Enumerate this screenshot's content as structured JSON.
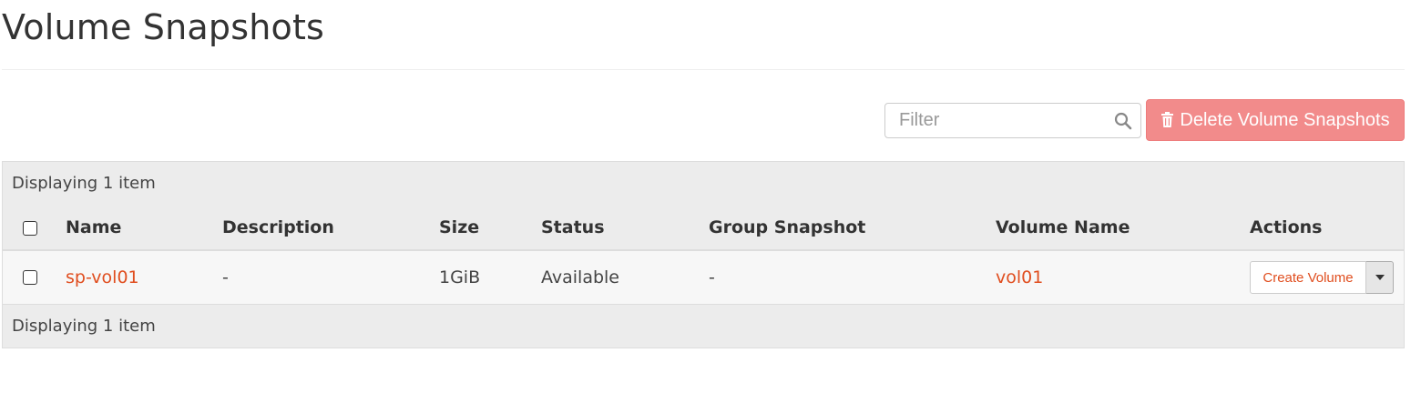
{
  "page": {
    "title": "Volume Snapshots"
  },
  "toolbar": {
    "filter_placeholder": "Filter",
    "delete_label": "Delete Volume Snapshots",
    "delete_color": "#f28b8b"
  },
  "table": {
    "info_text": "Displaying 1 item",
    "columns": [
      "Name",
      "Description",
      "Size",
      "Status",
      "Group Snapshot",
      "Volume Name",
      "Actions"
    ],
    "rows": [
      {
        "name": "sp-vol01",
        "description": "-",
        "size": "1GiB",
        "status": "Available",
        "group_snapshot": "-",
        "volume_name": "vol01",
        "action_label": "Create Volume"
      }
    ],
    "link_color": "#e04e1f"
  }
}
